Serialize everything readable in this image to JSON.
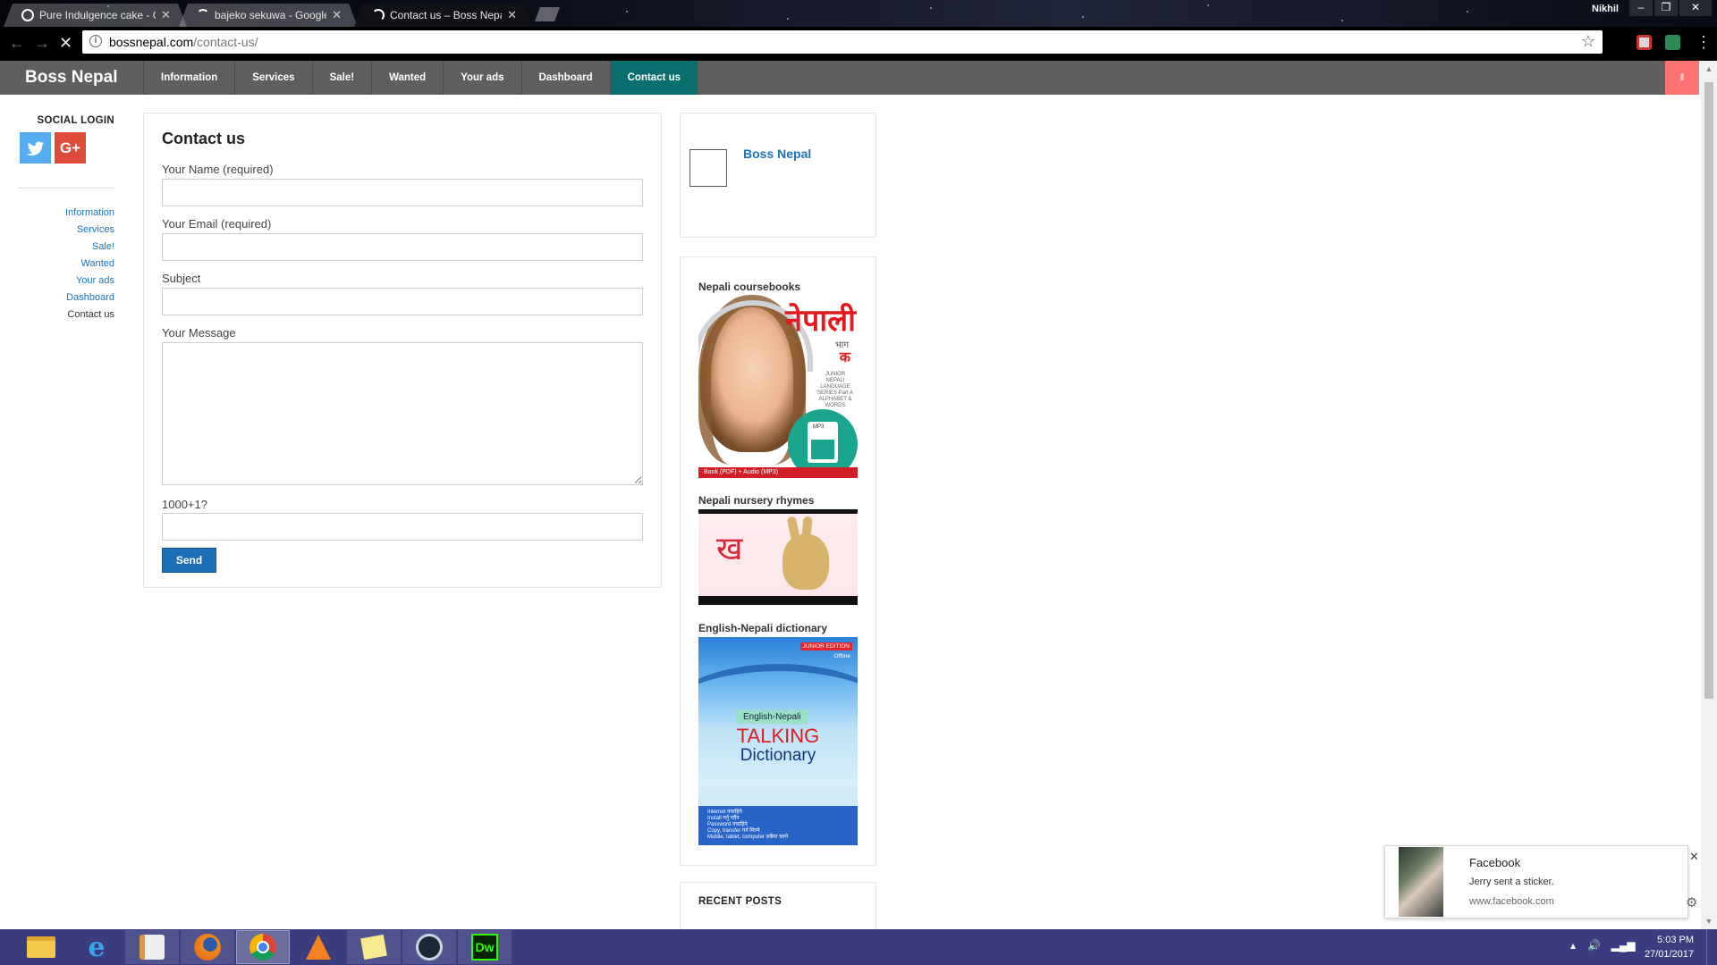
{
  "browser": {
    "tabs": [
      {
        "title": "Pure Indulgence cake - G",
        "active": false
      },
      {
        "title": "bajeko sekuwa - Google",
        "active": false
      },
      {
        "title": "Contact us – Boss Nepal",
        "active": true
      }
    ],
    "profile_name": "Nikhil",
    "url_host": "bossnepal.com",
    "url_path": "/contact-us/"
  },
  "site": {
    "title": "Boss Nepal",
    "nav": [
      "Information",
      "Services",
      "Sale!",
      "Wanted",
      "Your ads",
      "Dashboard",
      "Contact us"
    ],
    "active_nav": "Contact us"
  },
  "sidebar": {
    "social_title": "SOCIAL LOGIN",
    "menu": [
      "Information",
      "Services",
      "Sale!",
      "Wanted",
      "Your ads",
      "Dashboard",
      "Contact us"
    ]
  },
  "form": {
    "title": "Contact us",
    "name_label": "Your Name (required)",
    "email_label": "Your Email (required)",
    "subject_label": "Subject",
    "message_label": "Your Message",
    "captcha_label": "1000+1?",
    "name_value": "",
    "email_value": "",
    "subject_value": "",
    "message_value": "",
    "captcha_value": "",
    "send_label": "Send"
  },
  "widgets": {
    "author_name": "Boss Nepal",
    "ad1_title": "Nepali coursebooks",
    "ad1_art": {
      "title": "नेपाली",
      "part": "भाग",
      "letter": "क",
      "series": "JUNIOR NEPALI LANGUAGE SERIES Part A ALPHABET & WORDS",
      "mp3": "MP3",
      "footer": "Book (PDF) + Audio (MP3)"
    },
    "ad2_title": "Nepali nursery rhymes",
    "ad2_art": {
      "letter": "ख"
    },
    "ad3_title": "English-Nepali dictionary",
    "ad3_art": {
      "badge": "JUNIOR EDITION",
      "offline": "Offline",
      "lang": "English-Nepali",
      "talking": "TALKING",
      "dictionary": "Dictionary",
      "features": [
        "Internet नचाहिने",
        "Install गर्नु पर्दैन",
        "Password नचाहिने",
        "Copy, transfer गर्न मिल्ने",
        "Mobile, tablet, computer सबैमा चल्ने"
      ]
    },
    "recent_posts_title": "RECENT POSTS"
  },
  "notification": {
    "title": "Facebook",
    "body": "Jerry sent a sticker.",
    "source": "www.facebook.com"
  },
  "taskbar": {
    "apps": [
      "file-explorer",
      "internet-explorer",
      "paint",
      "firefox",
      "chrome",
      "vlc",
      "sticky-notes",
      "steam",
      "dreamweaver"
    ],
    "active_app": "chrome",
    "time": "5:03 PM",
    "date": "27/01/2017"
  },
  "colors": {
    "header_bg": "#5f5f5f",
    "nav_active": "#0b6e6e",
    "link": "#1e73be",
    "send_button": "#1d6fb8",
    "taskbar": "#3a3c7d",
    "twitter": "#55acee",
    "google_plus": "#dd4b39"
  }
}
